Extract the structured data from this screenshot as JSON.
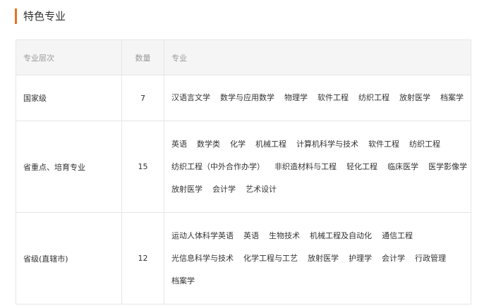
{
  "section_title": "特色专业",
  "table": {
    "headers": {
      "level": "专业层次",
      "count": "数量",
      "majors": "专业"
    },
    "rows": [
      {
        "level": "国家级",
        "count": "7",
        "lines": [
          [
            "汉语言文学",
            "数学与应用数学",
            "物理学",
            "软件工程",
            "纺织工程",
            "放射医学",
            "档案学"
          ]
        ]
      },
      {
        "level": "省重点、培育专业",
        "count": "15",
        "lines": [
          [
            "英语",
            "数学类",
            "化学",
            "机械工程",
            "计算机科学与技术",
            "软件工程",
            "纺织工程"
          ],
          [
            "纺织工程（中外合作办学）",
            "非织造材料与工程",
            "轻化工程",
            "临床医学",
            "医学影像学"
          ],
          [
            "放射医学",
            "会计学",
            "艺术设计"
          ]
        ]
      },
      {
        "level": "省级(直辖市)",
        "count": "12",
        "lines": [
          [
            "运动人体科学英语",
            "英语",
            "生物技术",
            "机械工程及自动化",
            "通信工程"
          ],
          [
            "光信息科学与技术",
            "化学工程与工艺",
            "放射医学",
            "护理学",
            "会计学",
            "行政管理"
          ],
          [
            "档案学"
          ]
        ]
      }
    ]
  },
  "colors": {
    "accent": "#e8711f",
    "header_bg": "#f5f5f5",
    "border": "#e6e6e6"
  }
}
